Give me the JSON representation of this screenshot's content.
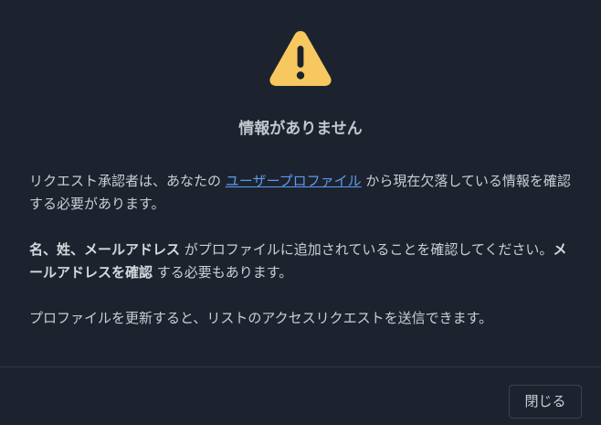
{
  "dialog": {
    "title": "情報がありません",
    "warning_color": "#f6c85f",
    "paragraph1": {
      "pre": "リクエスト承認者は、あなたの ",
      "link": "ユーザープロファイル",
      "post": " から現在欠落している情報を確認する必要があります。"
    },
    "paragraph2": {
      "strong1": "名、姓、メールアドレス",
      "mid": " がプロファイルに追加されていることを確認してください。",
      "strong2": "メールアドレスを確認",
      "post": " する必要もあります。"
    },
    "paragraph3": "プロファイルを更新すると、リストのアクセスリクエストを送信できます。",
    "close_label": "閉じる"
  }
}
